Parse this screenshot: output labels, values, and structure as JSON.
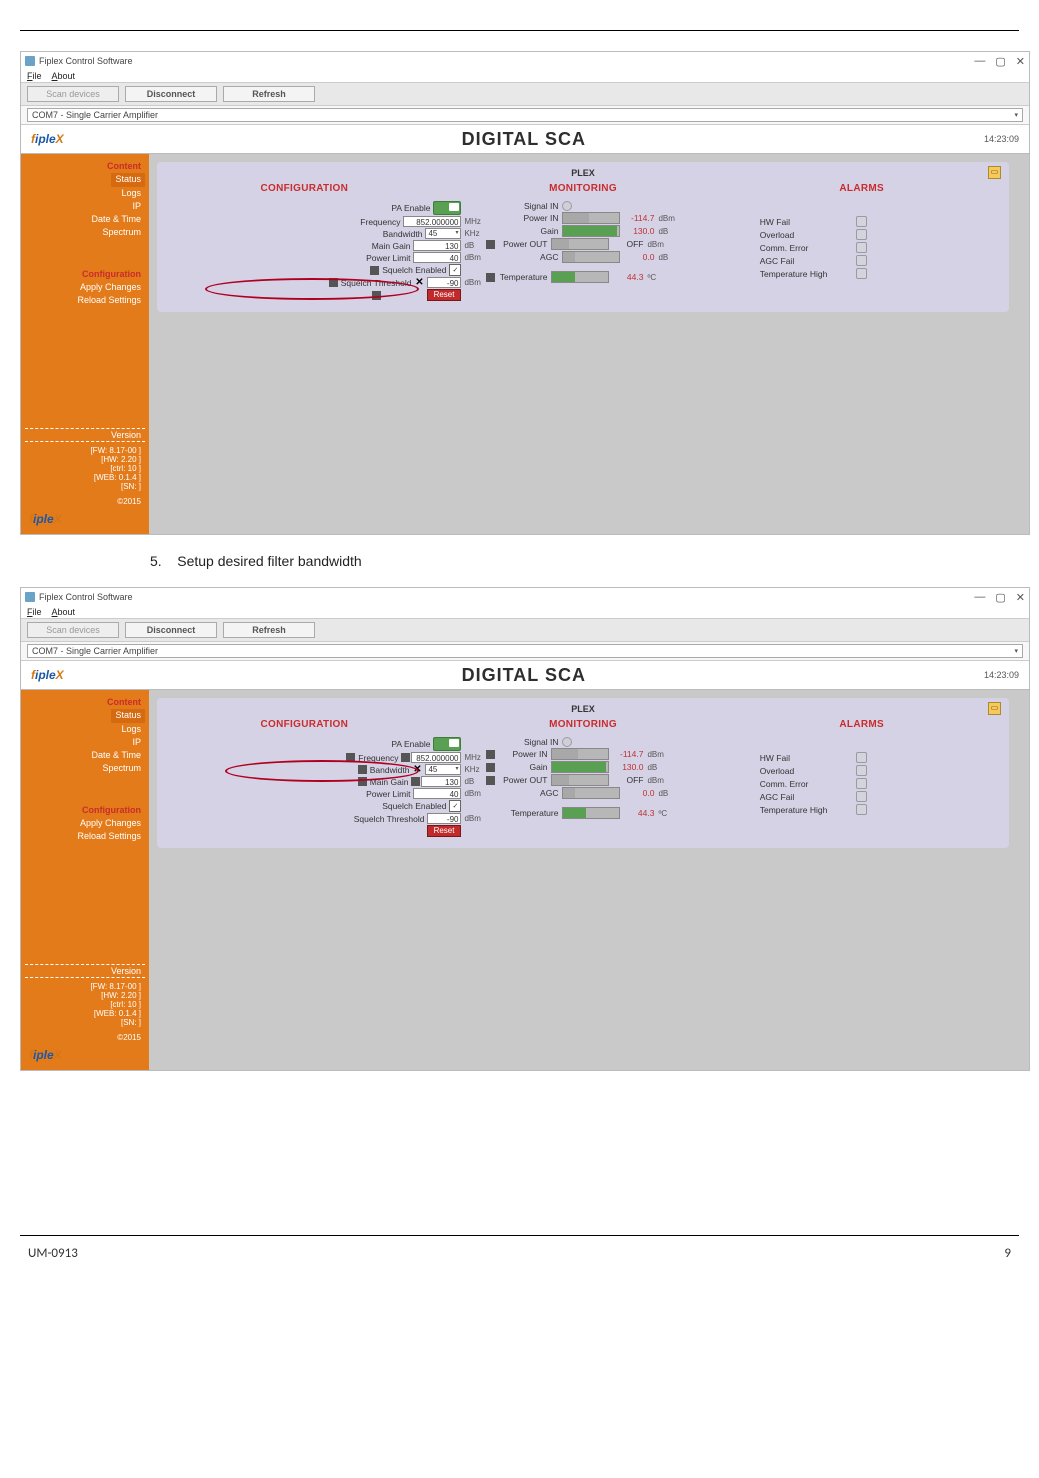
{
  "page": {
    "footer_left": "UM-0913",
    "footer_right": "9",
    "step_number": "5.",
    "step_text": "Setup desired filter bandwidth"
  },
  "app": {
    "title": "Fiplex Control Software",
    "menu": {
      "file": "File",
      "about": "About"
    },
    "toolbar": {
      "scan": "Scan devices",
      "disconnect": "Disconnect",
      "refresh": "Refresh"
    },
    "device_combo": "COM7 - Single Carrier Amplifier",
    "winbtns": {
      "min": "—",
      "max": "▢",
      "close": "✕"
    }
  },
  "brand": {
    "logo": "fipleX",
    "title": "DIGITAL SCA",
    "time": "14:23:09"
  },
  "sidebar": {
    "content": "Content",
    "status": "Status",
    "logs": "Logs",
    "ip": "IP",
    "datetime": "Date & Time",
    "spectrum": "Spectrum",
    "configuration": "Configuration",
    "apply": "Apply Changes",
    "reload": "Reload Settings",
    "version_title": "Version",
    "v1": "[FW: 8.17-00 ]",
    "v2": "[HW: 2.20 ]",
    "v3": "[ctrl:   10 ]",
    "v4": "[WEB: 0.1.4 ]",
    "v5": "[SN:  ]",
    "copy": "©2015"
  },
  "panel": {
    "title": "PLEX"
  },
  "headers": {
    "cfg": "CONFIGURATION",
    "mon": "MONITORING",
    "alm": "ALARMS"
  },
  "cfg": {
    "pa_enable": "PA Enable",
    "frequency": "Frequency",
    "frequency_val": "852.000000",
    "frequency_unit": "MHz",
    "bandwidth": "Bandwidth",
    "bandwidth_val": "45",
    "bandwidth_val2": "45",
    "bandwidth_unit": "KHz",
    "main_gain": "Main Gain",
    "main_gain_val": "130",
    "main_gain_unit": "dB",
    "power_limit": "Power Limit",
    "power_limit_val": "40",
    "power_limit_unit": "dBm",
    "squelch_enabled": "Squelch Enabled",
    "squelch_threshold": "Squelch Threshold",
    "squelch_threshold_val": "-90",
    "squelch_threshold_unit": "dBm",
    "reset": "Reset"
  },
  "mon": {
    "signal_in": "Signal IN",
    "power_in": "Power IN",
    "power_in_val": "-114.7",
    "power_in_unit": "dBm",
    "gain": "Gain",
    "gain_val": "130.0",
    "gain_unit": "dB",
    "power_out": "Power OUT",
    "power_out_val": "OFF",
    "power_out_unit": "dBm",
    "agc": "AGC",
    "agc_val": "0.0",
    "agc_unit": "dB",
    "temperature": "Temperature",
    "temperature_val": "44.3",
    "temperature_unit": "ºC"
  },
  "alarms": {
    "hw_fail": "HW Fail",
    "overload": "Overload",
    "comm_error": "Comm. Error",
    "agc_fail": "AGC Fail",
    "temp_high": "Temperature High"
  }
}
